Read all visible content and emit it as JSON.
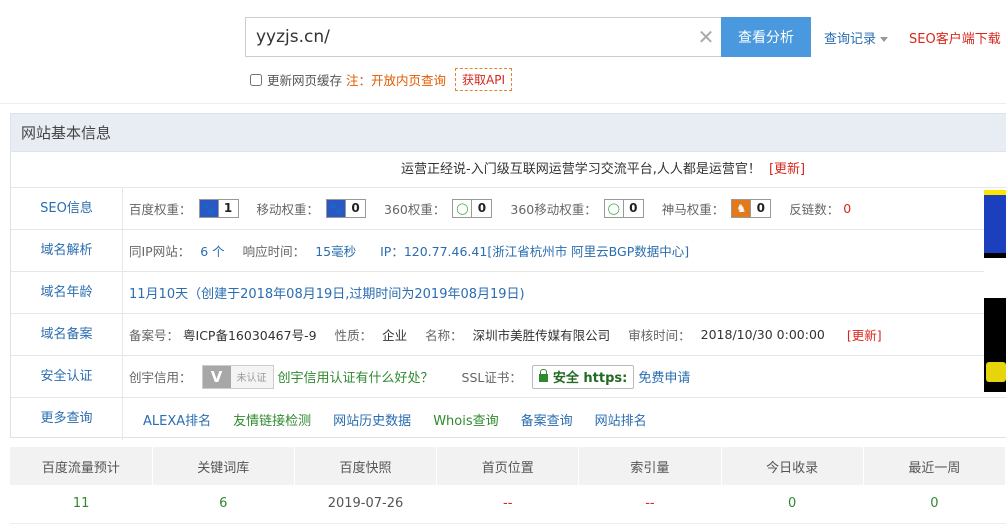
{
  "search": {
    "value": "yyzjs.cn/",
    "analyze_label": "查看分析",
    "history_label": "查询记录",
    "seo_client_label": "SEO客户端下载"
  },
  "options": {
    "refresh_cache_label": "更新网页缓存",
    "note_label": "注：开放内页查询",
    "api_label": "获取API"
  },
  "panel": {
    "header": "网站基本信息",
    "site_title": "运营正经说-入门级互联网运营学习交流平台,人人都是运营官！",
    "update_label": "[更新]"
  },
  "seo": {
    "label": "SEO信息",
    "baidu_label": "百度权重：",
    "baidu_value": "1",
    "mobile_label": "移动权重：",
    "mobile_value": "0",
    "r360_label": "360权重：",
    "r360_value": "0",
    "r360m_label": "360移动权重：",
    "r360m_value": "0",
    "shenma_label": "神马权重：",
    "shenma_value": "0",
    "backlinks_label": "反链数：",
    "backlinks_value": "0"
  },
  "dns": {
    "label": "域名解析",
    "same_ip_label": "同IP网站：",
    "same_ip_value": "6 个",
    "response_label": "响应时间：",
    "response_value": "15毫秒",
    "ip_text": "IP：120.77.46.41[浙江省杭州市 阿里云BGP数据中心]"
  },
  "age": {
    "label": "域名年龄",
    "value": "11月10天（创建于2018年08月19日,过期时间为2019年08月19日)"
  },
  "icp": {
    "label": "域名备案",
    "no_label": "备案号：",
    "no_value": "粤ICP备16030467号-9",
    "type_label": "性质：",
    "type_value": "企业",
    "name_label": "名称：",
    "name_value": "深圳市美胜传媒有限公司",
    "audit_label": "审核时间：",
    "audit_value": "2018/10/30 0:00:00",
    "update_label": "[更新]"
  },
  "security": {
    "label": "安全认证",
    "chuangyu_label": "创宇信用：",
    "cert_text": "未认证",
    "cert_link": "创宇信用认证有什么好处？",
    "ssl_label": "SSL证书：",
    "https_label": "安全 https:",
    "free_apply": "免费申请"
  },
  "more": {
    "label": "更多查询",
    "links": [
      "ALEXA排名",
      "友情链接检测",
      "网站历史数据",
      "Whois查询",
      "备案查询",
      "网站排名"
    ]
  },
  "stats": {
    "headers": [
      "百度流量预计",
      "关键词库",
      "百度快照",
      "首页位置",
      "索引量",
      "今日收录",
      "最近一周"
    ],
    "values": [
      "11",
      "6",
      "2019-07-26",
      "--",
      "--",
      "0",
      "0"
    ]
  },
  "colors": {
    "accent": "#4a98de",
    "link": "#2a6db0",
    "alert": "#d9261c",
    "good": "#2f8a2f"
  }
}
